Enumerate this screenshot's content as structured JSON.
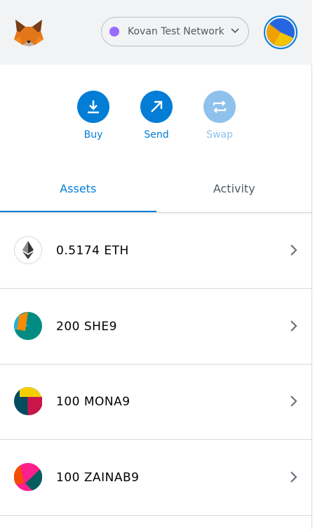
{
  "header": {
    "network": "Kovan Test Network"
  },
  "actions": [
    {
      "label": "Buy"
    },
    {
      "label": "Send"
    },
    {
      "label": "Swap"
    }
  ],
  "tabs": [
    {
      "label": "Assets"
    },
    {
      "label": "Activity"
    }
  ],
  "assets": [
    {
      "label": "0.5174 ETH"
    },
    {
      "label": "200 SHE9"
    },
    {
      "label": "100 MONA9"
    },
    {
      "label": "100 ZAINAB9"
    }
  ],
  "colors": {
    "accent": "#037dd6",
    "network_dot": "#9a6bff"
  }
}
